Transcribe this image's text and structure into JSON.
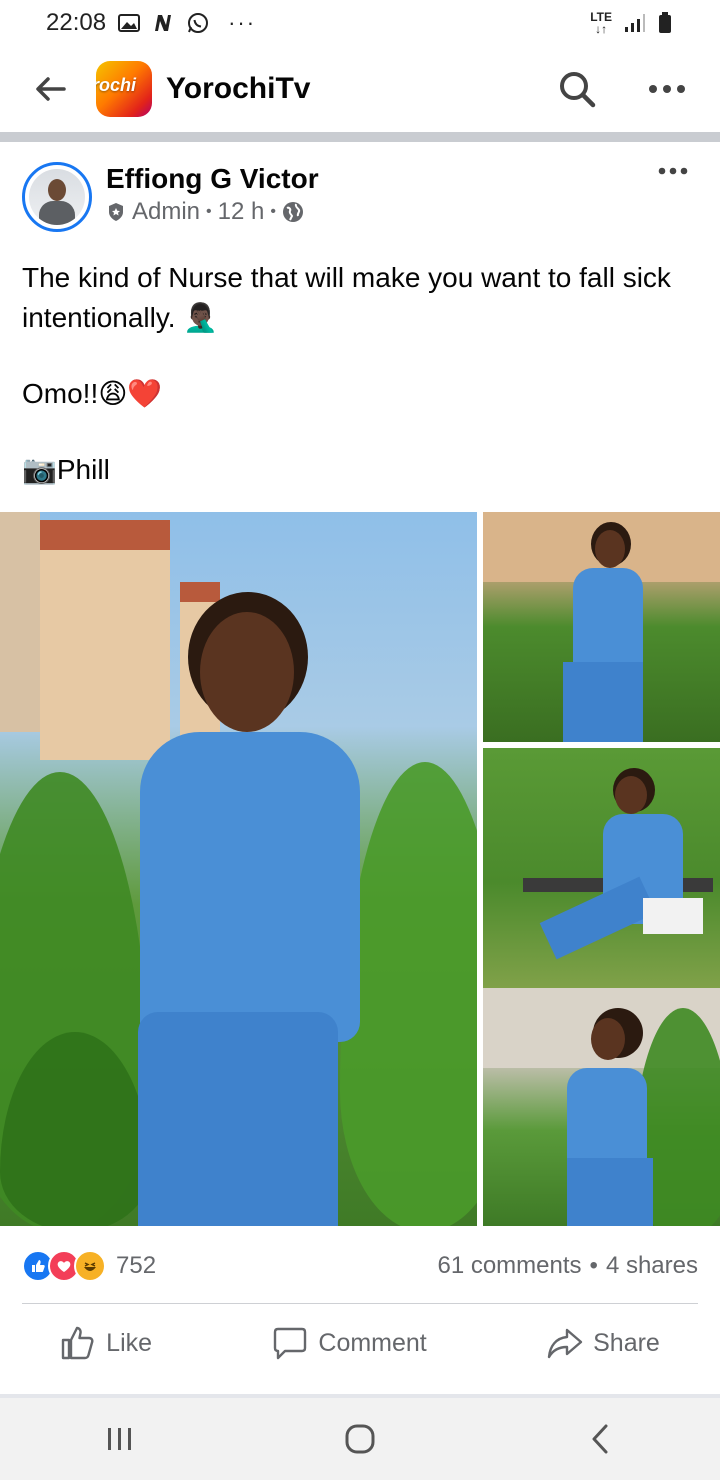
{
  "status_bar": {
    "time": "22:08",
    "left_icons": [
      "gallery-icon",
      "n-icon",
      "whatsapp-icon"
    ],
    "more": "···",
    "network": "LTE",
    "right_icons": [
      "signal-icon",
      "battery-icon"
    ]
  },
  "app_bar": {
    "title": "YorochiTv",
    "logo_text": "rochi",
    "brand_colors": [
      "#f5c400",
      "#ff7a00",
      "#e2231a",
      "#b1006a"
    ]
  },
  "post": {
    "author": "Effiong G Victor",
    "role": "Admin",
    "time": "12 h",
    "text_lines": [
      "The kind of Nurse that will make you want to fall sick intentionally.",
      "Omo!!",
      "Phill"
    ],
    "emojis": {
      "line1": "🤦🏿‍♂️",
      "line2": "😩❤️",
      "camera": "📷"
    },
    "photos": [
      {
        "name": "photo-main",
        "subject": "nurse in blue scrubs with stethoscope"
      },
      {
        "name": "photo-side-1",
        "subject": "nurse seated on bench"
      },
      {
        "name": "photo-side-2",
        "subject": "nurse on bench with first aid box"
      },
      {
        "name": "photo-side-3",
        "subject": "nurse standing near plants"
      }
    ],
    "reaction_count": "752",
    "comments": "61 comments",
    "shares": "4 shares",
    "separator": "•"
  },
  "actions": {
    "like": "Like",
    "comment": "Comment",
    "share": "Share"
  },
  "colors": {
    "accent": "#1877f2",
    "muted_text": "#65676b",
    "love": "#f33e58",
    "haha": "#f7b125"
  }
}
